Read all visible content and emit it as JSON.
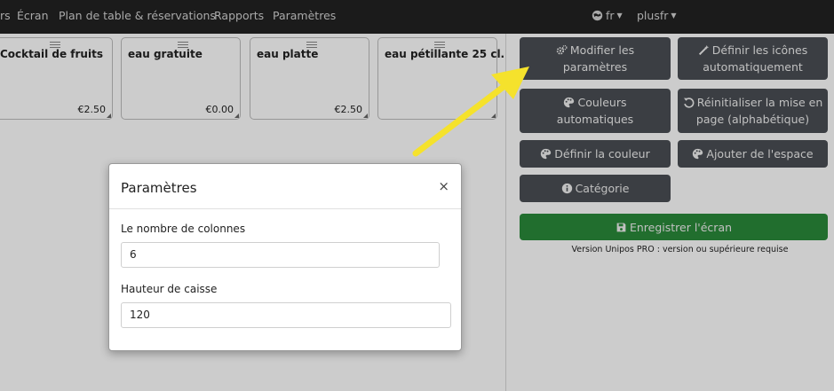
{
  "nav": {
    "items": [
      "rs",
      "Écran",
      "Plan de table & réservations",
      "Rapports",
      "Paramètres"
    ],
    "language": "fr",
    "user": "plusfr"
  },
  "products": [
    {
      "name": "Cocktail de fruits",
      "price": "€2.50"
    },
    {
      "name": "eau gratuite",
      "price": "€0.00"
    },
    {
      "name": "eau platte",
      "price": "€2.50"
    },
    {
      "name": "eau pétillante 25 cl.",
      "price": ""
    }
  ],
  "side_buttons": {
    "modify_settings": {
      "line1": "Modifier les",
      "line2": "paramètres",
      "icon": "gears-icon"
    },
    "auto_icons": {
      "line1": "Définir les icônes",
      "line2": "automatiquement",
      "icon": "magic-wand-icon"
    },
    "auto_colors": {
      "line1": "Couleurs",
      "line2": "automatiques",
      "icon": "palette-icon"
    },
    "reset_layout": {
      "line1": "Réinitialiser la mise en",
      "line2": "page (alphabétique)",
      "icon": "undo-icon"
    },
    "set_color": {
      "label": "Définir la couleur",
      "icon": "palette-icon"
    },
    "add_space": {
      "label": "Ajouter de l'espace",
      "icon": "palette-icon"
    },
    "category": {
      "label": "Catégorie",
      "icon": "info-icon"
    },
    "save_screen": {
      "label": "Enregistrer l'écran",
      "icon": "floppy-icon"
    }
  },
  "notice": "Version Unipos PRO : version ou supérieure requise",
  "modal": {
    "title": "Paramètres",
    "close": "×",
    "fields": {
      "columns": {
        "label": "Le nombre de colonnes",
        "value": "6"
      },
      "height": {
        "label": "Hauteur de caisse",
        "value": "120"
      }
    }
  },
  "colors": {
    "topbar": "#222222",
    "button": "#4a4e54",
    "save": "#2a8a3a",
    "arrow": "#f5e22c"
  }
}
